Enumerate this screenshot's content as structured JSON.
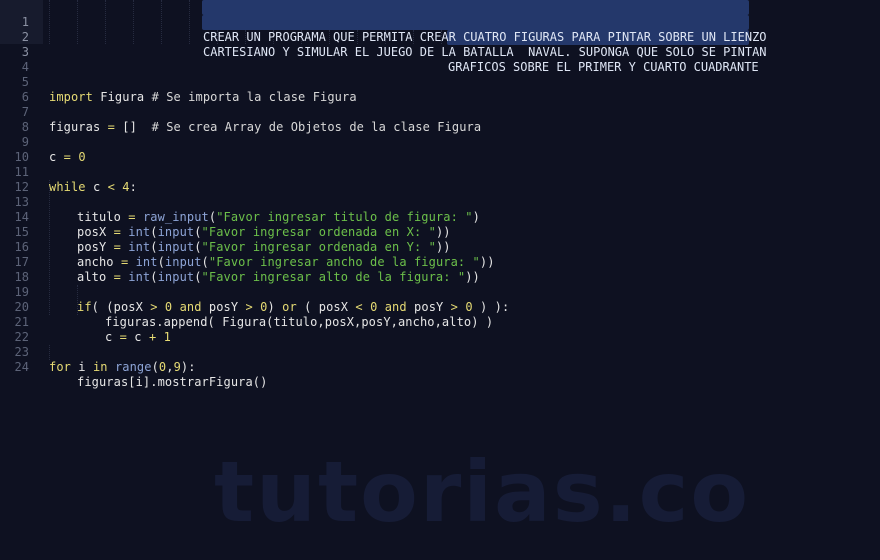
{
  "editor": {
    "language": "python",
    "colors": {
      "background": "#0e1121",
      "selection": "#24386b",
      "keyword": "#e6db74",
      "string": "#6cc04a",
      "builtin": "#8da4d6",
      "line_number": "#5c6378"
    },
    "selected_lines": [
      1,
      2,
      3
    ],
    "lines": [
      {
        "n": "1",
        "text": "CREAR UN PROGRAMA QUE PERMITA CREAR CUATRO FIGURAS PARA PINTAR SOBRE UN LIENZO"
      },
      {
        "n": "2",
        "text": "CARTESIANO Y SIMULAR EL JUEGO DE LA BATALLA  NAVAL. SUPONGA QUE SOLO SE PINTAN"
      },
      {
        "n": "3",
        "text": "GRAFICOS SOBRE EL PRIMER Y CUARTO CUADRANTE"
      },
      {
        "n": "4",
        "text": ""
      },
      {
        "n": "5",
        "parts": [
          "import",
          " Figura ",
          "# Se importa la clase Figura"
        ]
      },
      {
        "n": "6",
        "text": ""
      },
      {
        "n": "7",
        "parts": [
          "figuras ",
          "=",
          " []  ",
          "# Se crea Array de Objetos de la clase Figura"
        ]
      },
      {
        "n": "8",
        "text": ""
      },
      {
        "n": "9",
        "parts": [
          "c ",
          "=",
          " ",
          "0"
        ]
      },
      {
        "n": "10",
        "text": ""
      },
      {
        "n": "11",
        "parts": [
          "while",
          " c ",
          "<",
          " ",
          "4",
          ":"
        ]
      },
      {
        "n": "12",
        "text": ""
      },
      {
        "n": "13",
        "parts": [
          "titulo ",
          "=",
          " ",
          "raw_input",
          "(",
          "\"Favor ingresar titulo de figura: \"",
          ")"
        ]
      },
      {
        "n": "14",
        "parts": [
          "posX ",
          "=",
          " ",
          "int",
          "(",
          "input",
          "(",
          "\"Favor ingresar ordenada en X: \"",
          "))"
        ]
      },
      {
        "n": "15",
        "parts": [
          "posY ",
          "=",
          " ",
          "int",
          "(",
          "input",
          "(",
          "\"Favor ingresar ordenada en Y: \"",
          "))"
        ]
      },
      {
        "n": "16",
        "parts": [
          "ancho ",
          "=",
          " ",
          "int",
          "(",
          "input",
          "(",
          "\"Favor ingresar ancho de la figura: \"",
          "))"
        ]
      },
      {
        "n": "17",
        "parts": [
          "alto ",
          "=",
          " ",
          "int",
          "(",
          "input",
          "(",
          "\"Favor ingresar alto de la figura: \"",
          "))"
        ]
      },
      {
        "n": "18",
        "text": ""
      },
      {
        "n": "19",
        "parts": [
          "if",
          "( (posX ",
          ">",
          " ",
          "0",
          " ",
          "and",
          " posY ",
          ">",
          " ",
          "0",
          ") ",
          "or",
          " ( posX ",
          "<",
          " ",
          "0",
          " ",
          "and",
          " posY ",
          ">",
          " ",
          "0",
          " ) ):"
        ]
      },
      {
        "n": "20",
        "text": "figuras.append( Figura(titulo,posX,posY,ancho,alto) )"
      },
      {
        "n": "21",
        "parts": [
          "c ",
          "=",
          " c ",
          "+",
          " ",
          "1"
        ]
      },
      {
        "n": "22",
        "text": ""
      },
      {
        "n": "23",
        "parts": [
          "for",
          " i ",
          "in",
          " ",
          "range",
          "(",
          "0",
          ",",
          "9",
          "):"
        ]
      },
      {
        "n": "24",
        "text": "figuras[i].mostrarFigura()"
      }
    ]
  },
  "watermark": {
    "text": "tutorias.co"
  }
}
